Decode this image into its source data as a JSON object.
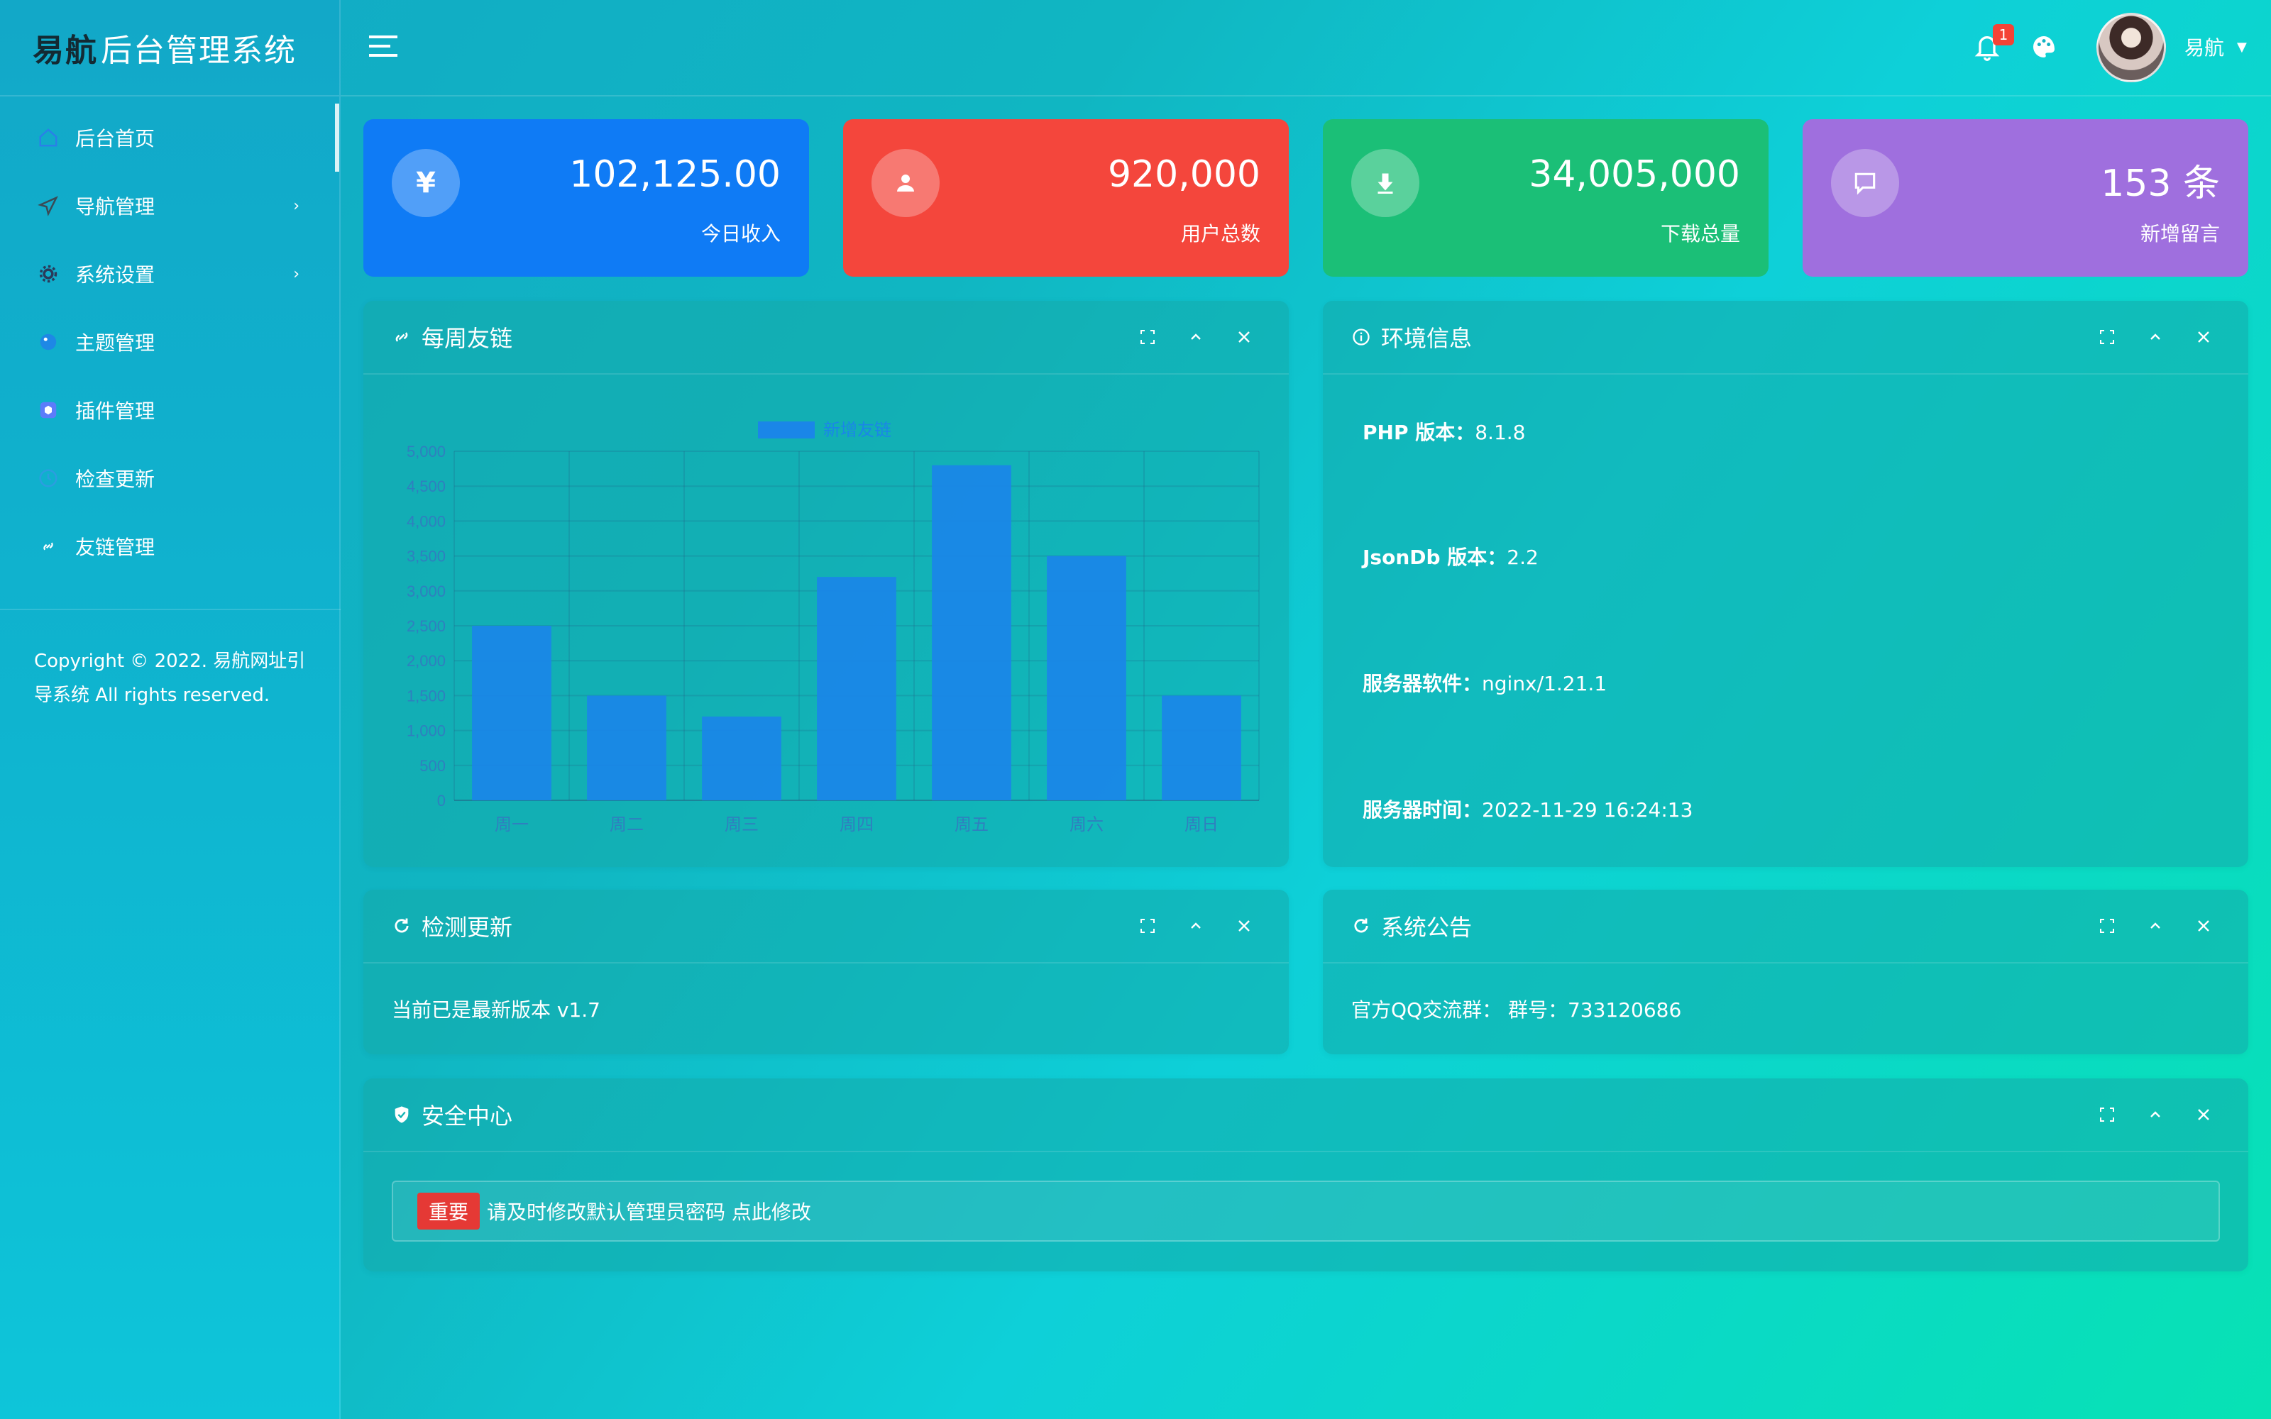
{
  "sidebar": {
    "logo_brand": "易航",
    "logo_rest": "后台管理系统",
    "items": [
      {
        "label": "后台首页",
        "icon": "home-icon",
        "arrow": ""
      },
      {
        "label": "导航管理",
        "icon": "send-icon",
        "arrow": "›"
      },
      {
        "label": "系统设置",
        "icon": "gear-icon",
        "arrow": "›"
      },
      {
        "label": "主题管理",
        "icon": "theme-icon",
        "arrow": ""
      },
      {
        "label": "插件管理",
        "icon": "plugin-icon",
        "arrow": ""
      },
      {
        "label": "检查更新",
        "icon": "update-icon",
        "arrow": ""
      },
      {
        "label": "友链管理",
        "icon": "link-icon",
        "arrow": ""
      }
    ],
    "copyright": "Copyright © 2022. 易航网址引导系统 All rights reserved."
  },
  "header": {
    "notification_count": "1",
    "username": "易航"
  },
  "stats": [
    {
      "value": "102,125.00",
      "label": "今日收入",
      "icon_glyph": "¥",
      "color": "#0f7bf5"
    },
    {
      "value": "920,000",
      "label": "用户总数",
      "icon_glyph": "",
      "color": "#f4463c"
    },
    {
      "value": "34,005,000",
      "label": "下载总量",
      "icon_glyph": "",
      "color": "#1bbf77"
    },
    {
      "value": "153 条",
      "label": "新增留言",
      "icon_glyph": "",
      "color": "#9f6fde"
    }
  ],
  "panels": {
    "weekly_links": {
      "title": "每周友链"
    },
    "environment": {
      "title": "环境信息",
      "rows": [
        {
          "key": "PHP 版本：",
          "value": "8.1.8"
        },
        {
          "key": "JsonDb 版本：",
          "value": "2.2"
        },
        {
          "key": "服务器软件：",
          "value": "nginx/1.21.1"
        },
        {
          "key": "服务器时间：",
          "value": "2022-11-29 16:24:13"
        }
      ]
    },
    "check_update": {
      "title": "检测更新",
      "text": "当前已是最新版本 v1.7"
    },
    "announcement": {
      "title": "系统公告",
      "text": "官方QQ交流群：  群号：733120686"
    },
    "security": {
      "title": "安全中心",
      "tag": "重要",
      "text": "请及时修改默认管理员密码 点此修改"
    }
  },
  "chart_data": {
    "type": "bar",
    "legend": "新增友链",
    "categories": [
      "周一",
      "周二",
      "周三",
      "周四",
      "周五",
      "周六",
      "周日"
    ],
    "series": [
      {
        "name": "新增友链",
        "values": [
          2500,
          1500,
          1200,
          3200,
          4800,
          3500,
          1500
        ]
      }
    ],
    "yticks": [
      "5,000",
      "4,500",
      "4,000",
      "3,500",
      "3,000",
      "2,500",
      "2,000",
      "1,500",
      "1,000",
      "500",
      "0"
    ],
    "ylim": [
      0,
      5000
    ],
    "bar_color": "#1a86e8",
    "grid": true
  }
}
